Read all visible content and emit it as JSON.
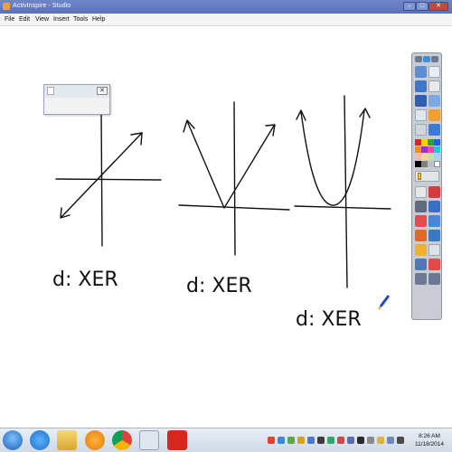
{
  "window": {
    "title": "ActivInspire - Studio"
  },
  "window_controls": {
    "minimize": "–",
    "maximize": "□",
    "close": "✕"
  },
  "menu": {
    "items": [
      "File",
      "Edit",
      "View",
      "Insert",
      "Tools",
      "Help"
    ]
  },
  "mini_window": {
    "close_label": "✕"
  },
  "canvas": {
    "annotations": [
      {
        "text": "d: XER"
      },
      {
        "text": "d: XER"
      },
      {
        "text": "d: XER"
      }
    ]
  },
  "toolbox": {
    "colors": [
      "#e52020",
      "#ffd400",
      "#1fa82a",
      "#2060e0",
      "#ff8c00",
      "#9b30c8",
      "#ff40a0",
      "#20c8d8",
      "#f6b6b6",
      "#f5d59a",
      "#b9e6a0",
      "#a8d0f0",
      "#000000",
      "#808080",
      "#c0c0c0",
      "#ffffff"
    ]
  },
  "taskbar": {
    "apps": [
      "start-orb",
      "internet-explorer",
      "file-explorer",
      "media-player",
      "chrome",
      "activinspire",
      "acrobat-reader"
    ],
    "time": "8:26 AM",
    "date": "11/18/2014"
  }
}
